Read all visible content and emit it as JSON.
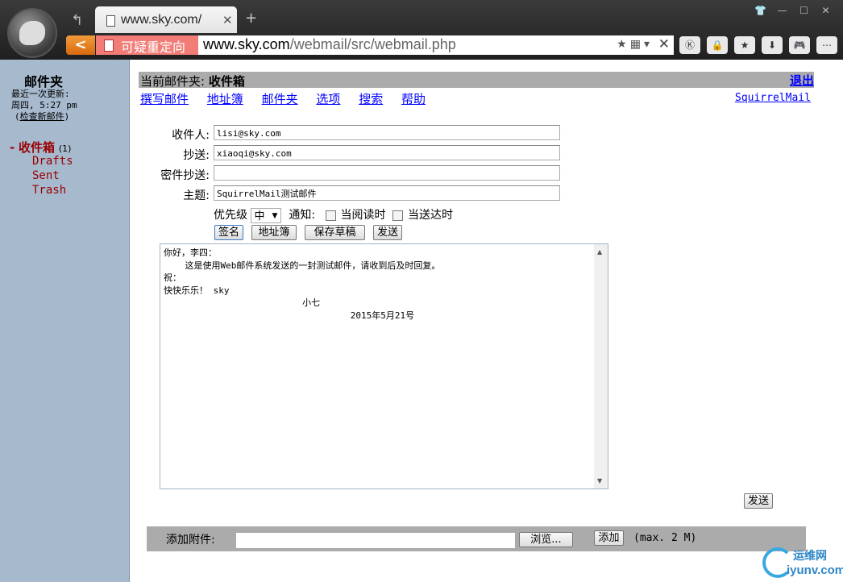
{
  "browser": {
    "tab_title": "www.sky.com/",
    "warning_label": "可疑重定向",
    "url_host": "www.sky.com",
    "url_path": "/webmail/src/webmail.php"
  },
  "sidebar": {
    "title": "邮件夹",
    "last_update_label": "最近一次更新:",
    "last_update_time": "周四, 5:27 pm",
    "check_mail_open": "(",
    "check_mail_link": "检查新邮件",
    "check_mail_close": ")",
    "inbox_dash": "-",
    "inbox_label": "收件箱",
    "inbox_count": "(1)",
    "folders": [
      "Drafts",
      "Sent",
      "Trash"
    ]
  },
  "header": {
    "current_folder_label": "当前邮件夹:",
    "current_folder": "收件箱",
    "logout": "退出"
  },
  "menu": {
    "items": [
      "撰写邮件",
      "地址簿",
      "邮件夹",
      "选项",
      "搜索",
      "帮助"
    ],
    "brand": "SquirrelMail"
  },
  "compose": {
    "to_label": "收件人:",
    "to_value": "lisi@sky.com",
    "cc_label": "抄送:",
    "cc_value": "xiaoqi@sky.com",
    "bcc_label": "密件抄送:",
    "bcc_value": "",
    "subject_label": "主题:",
    "subject_value": "SquirrelMail测试邮件",
    "priority_label": "优先级",
    "priority_value": "中",
    "notify_label": "通知:",
    "read_receipt_label": "当阅读时",
    "delivery_receipt_label": "当送达时",
    "signature_button": "签名",
    "addressbook_button": "地址簿",
    "save_draft_button": "保存草稿",
    "send_button": "发送",
    "body": "你好，李四：\n    这是使用Web邮件系统发送的一封测试邮件，请收到后及时回复。\n祝：\n快快乐乐！ sky\n                          小七\n                                   2015年5月21号",
    "send_button_bottom": "发送"
  },
  "attachment": {
    "label": "添加附件:",
    "browse_button": "浏览...",
    "add_button": "添加",
    "max_size": "(max. 2 M)"
  },
  "watermark": {
    "cn": "运维网",
    "en": "iyunv.com"
  }
}
